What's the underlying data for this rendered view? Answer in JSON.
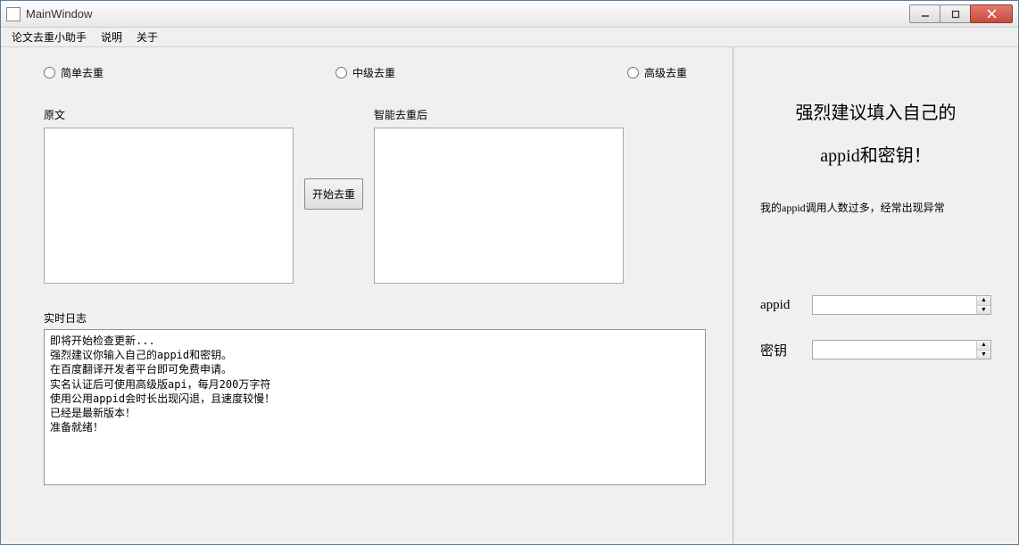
{
  "window": {
    "title": "MainWindow"
  },
  "menu": {
    "assistant": "论文去重小助手",
    "help": "说明",
    "about": "关于"
  },
  "radios": {
    "simple": "简单去重",
    "medium": "中级去重",
    "advanced": "高级去重"
  },
  "io": {
    "original_label": "原文",
    "result_label": "智能去重后",
    "original_value": "",
    "result_value": "",
    "start_button": "开始去重"
  },
  "log": {
    "label": "实时日志",
    "content": "即将开始检查更新...\n强烈建议你输入自己的appid和密钥。\n在百度翻译开发者平台即可免费申请。\n实名认证后可使用高级版api，每月200万字符\n使用公用appid会时长出现闪退，且速度较慢！\n已经是最新版本！\n准备就绪！"
  },
  "advice": {
    "big_line1": "强烈建议填入自己的",
    "big_line2": "appid和密钥！",
    "note": "我的appid调用人数过多，经常出现异常"
  },
  "credentials": {
    "appid_label": "appid",
    "appid_value": "",
    "secret_label": "密钥",
    "secret_value": ""
  }
}
